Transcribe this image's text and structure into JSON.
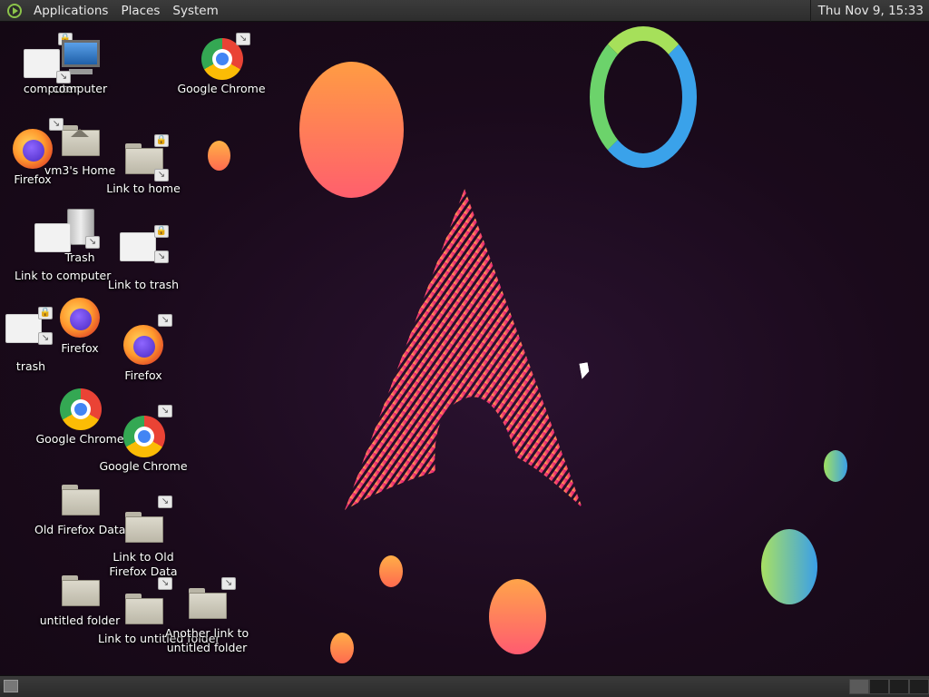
{
  "top_panel": {
    "menus": [
      "Applications",
      "Places",
      "System"
    ],
    "clock": "Thu Nov  9, 15:33"
  },
  "desktop_icons": {
    "computer": "computer",
    "computer_overlap": "computer",
    "google_chrome_1": "Google Chrome",
    "firefox_1": "Firefox",
    "home": "vm3's Home",
    "link_to_home": "Link to home",
    "trash": "Trash",
    "link_to_computer": "Link to computer",
    "link_to_trash": "Link to trash",
    "firefox_2": "Firefox",
    "trash_link": "trash",
    "firefox_3": "Firefox",
    "google_chrome_2": "Google Chrome",
    "google_chrome_3": "Google Chrome",
    "old_firefox_data": "Old Firefox Data",
    "link_to_old_firefox_data": "Link to Old Firefox Data",
    "untitled_folder": "untitled folder",
    "link_to_untitled_folder": "Link to untitled folder",
    "another_link_to_untitled_folder": "Another link to untitled folder"
  },
  "icons": {
    "menu_logo": "arch-logo-icon",
    "show_desktop": "show-desktop-icon"
  },
  "colors": {
    "panel_bg": "#333333",
    "desktop_bg": "#1c0b1c",
    "accent_green": "#8bc34a"
  }
}
